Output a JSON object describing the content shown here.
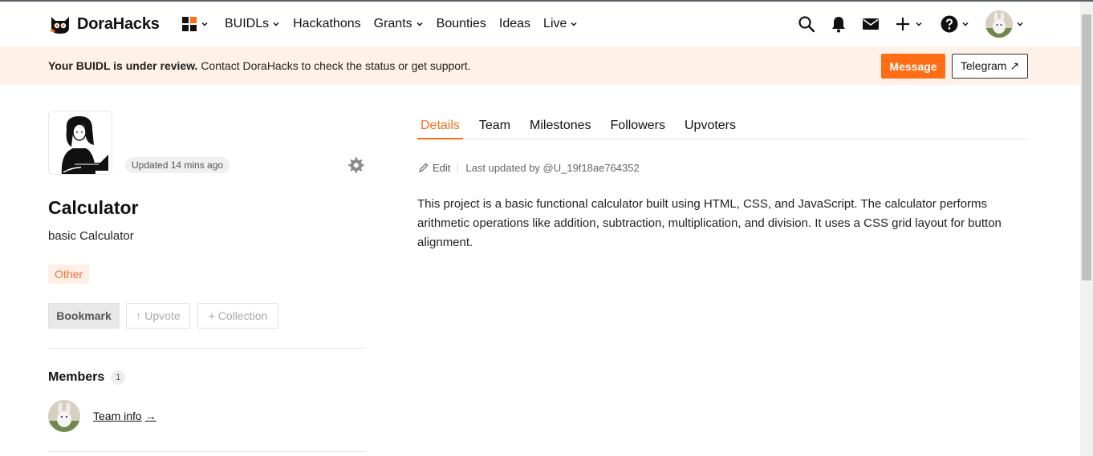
{
  "brand": {
    "name": "DoraHacks"
  },
  "nav": {
    "items": [
      {
        "label": "BUIDLs",
        "has_dropdown": true
      },
      {
        "label": "Hackathons",
        "has_dropdown": false
      },
      {
        "label": "Grants",
        "has_dropdown": true
      },
      {
        "label": "Bounties",
        "has_dropdown": false
      },
      {
        "label": "Ideas",
        "has_dropdown": false
      },
      {
        "label": "Live",
        "has_dropdown": true
      }
    ]
  },
  "header_icons": [
    "search-icon",
    "bell-icon",
    "mail-icon",
    "plus-icon",
    "help-icon",
    "user-avatar"
  ],
  "banner": {
    "bold_text": "Your BUIDL is under review.",
    "text": " Contact DoraHacks to check the status or get support.",
    "message_label": "Message",
    "telegram_label": "Telegram ↗"
  },
  "project": {
    "updated": "Updated 14 mins ago",
    "name": "Calculator",
    "tagline": "basic Calculator",
    "tag": "Other",
    "bookmark_label": "Bookmark",
    "upvote_label": "↑ Upvote",
    "collection_label": "+ Collection"
  },
  "members": {
    "title": "Members",
    "count": "1",
    "team_info_label": "Team info",
    "team_info_arrow": "→"
  },
  "tabs": [
    {
      "label": "Details",
      "active": true
    },
    {
      "label": "Team",
      "active": false
    },
    {
      "label": "Milestones",
      "active": false
    },
    {
      "label": "Followers",
      "active": false
    },
    {
      "label": "Upvoters",
      "active": false
    }
  ],
  "details": {
    "edit_label": "Edit",
    "last_updated": "Last updated by @U_19f18ae764352",
    "description": "This project is a basic functional calculator built using HTML, CSS, and JavaScript. The calculator performs arithmetic operations like addition, subtraction, multiplication, and division. It uses a CSS grid layout for button alignment."
  },
  "colors": {
    "accent": "#ff6d14",
    "banner_bg": "#fdf1e8",
    "tag_bg": "#fdeee6",
    "tag_text": "#f0703a"
  }
}
